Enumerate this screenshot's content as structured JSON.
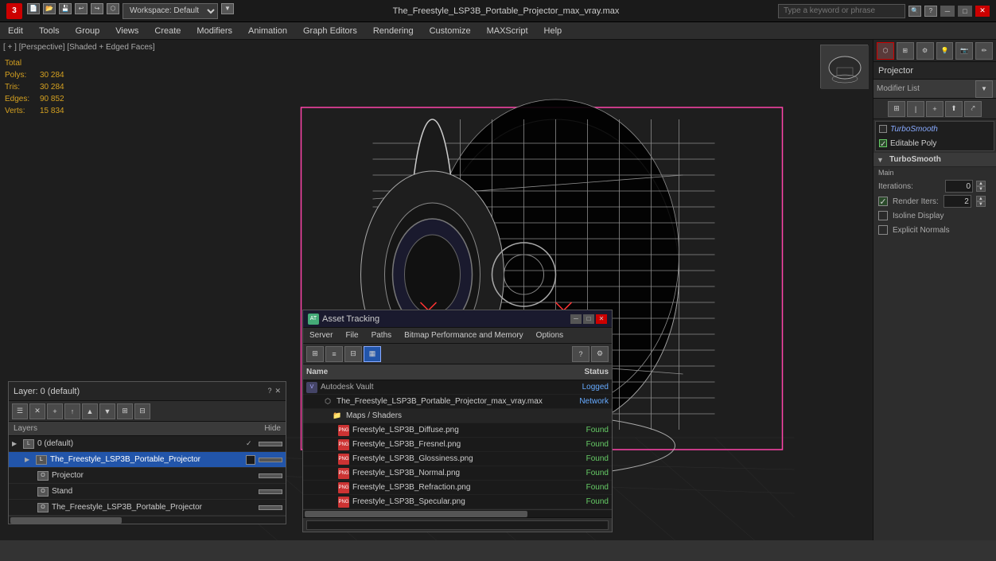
{
  "titlebar": {
    "app_icon": "3",
    "title": "The_Freestyle_LSP3B_Portable_Projector_max_vray.max",
    "search_placeholder": "Type a keyword or phrase",
    "workspace": "Workspace: Default",
    "min": "─",
    "max": "□",
    "close": "✕"
  },
  "menubar": {
    "items": [
      "Edit",
      "Tools",
      "Group",
      "Views",
      "Create",
      "Modifiers",
      "Animation",
      "Graph Editors",
      "Rendering",
      "Customize",
      "MAXScript",
      "Help"
    ]
  },
  "viewport": {
    "label": "[ + ] [Perspective] [Shaded + Edged Faces]",
    "stats": {
      "polys_label": "Polys:",
      "polys_value": "30 284",
      "tris_label": "Tris:",
      "tris_value": "30 284",
      "edges_label": "Edges:",
      "edges_value": "90 852",
      "verts_label": "Verts:",
      "verts_value": "15 834",
      "total": "Total"
    }
  },
  "right_panel": {
    "title": "Projector",
    "modifier_list": "Modifier List",
    "modifiers": [
      {
        "name": "TurboSmooth",
        "type": "turbosmooth",
        "checked": false
      },
      {
        "name": "Editable Poly",
        "type": "editable-poly",
        "checked": true
      }
    ],
    "turbosmooth": {
      "header": "TurboSmooth",
      "main_label": "Main",
      "iterations_label": "Iterations:",
      "iterations_value": "0",
      "render_iters_label": "Render Iters:",
      "render_iters_value": "2",
      "isoline_label": "Isoline Display",
      "explicit_label": "Explicit Normals"
    }
  },
  "layer_panel": {
    "title": "Layer: 0 (default)",
    "hide_label": "Hide",
    "layers": [
      {
        "name": "0 (default)",
        "indent": 0,
        "selected": false,
        "default": true,
        "has_check": true
      },
      {
        "name": "The_Freestyle_LSP3B_Portable_Projector",
        "indent": 1,
        "selected": true
      },
      {
        "name": "Projector",
        "indent": 2,
        "selected": false
      },
      {
        "name": "Stand",
        "indent": 2,
        "selected": false
      },
      {
        "name": "The_Freestyle_LSP3B_Portable_Projector",
        "indent": 2,
        "selected": false
      }
    ]
  },
  "asset_tracking": {
    "title": "Asset Tracking",
    "menu": [
      "Server",
      "File",
      "Paths",
      "Bitmap Performance and Memory",
      "Options"
    ],
    "columns": {
      "name": "Name",
      "status": "Status"
    },
    "items": [
      {
        "indent": 0,
        "icon": "vault",
        "name": "Autodesk Vault",
        "status": "Logged",
        "status_color": "blue",
        "type": "vault"
      },
      {
        "indent": 1,
        "icon": "file",
        "name": "The_Freestyle_LSP3B_Portable_Projector_max_vray.max",
        "status": "Network",
        "status_color": "blue",
        "type": "network"
      },
      {
        "indent": 2,
        "icon": "folder",
        "name": "Maps / Shaders",
        "status": "",
        "type": "folder"
      },
      {
        "indent": 3,
        "icon": "png",
        "name": "Freestyle_LSP3B_Diffuse.png",
        "status": "Found",
        "type": "found"
      },
      {
        "indent": 3,
        "icon": "png",
        "name": "Freestyle_LSP3B_Fresnel.png",
        "status": "Found",
        "type": "found"
      },
      {
        "indent": 3,
        "icon": "png",
        "name": "Freestyle_LSP3B_Glossiness.png",
        "status": "Found",
        "type": "found"
      },
      {
        "indent": 3,
        "icon": "png",
        "name": "Freestyle_LSP3B_Normal.png",
        "status": "Found",
        "type": "found"
      },
      {
        "indent": 3,
        "icon": "png",
        "name": "Freestyle_LSP3B_Refraction.png",
        "status": "Found",
        "type": "found"
      },
      {
        "indent": 3,
        "icon": "png",
        "name": "Freestyle_LSP3B_Specular.png",
        "status": "Found",
        "type": "found"
      }
    ]
  }
}
